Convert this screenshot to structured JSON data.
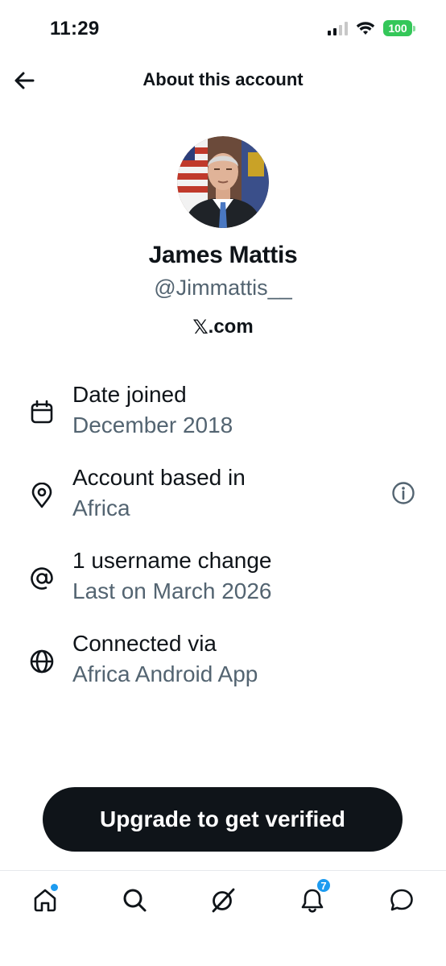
{
  "status_bar": {
    "time": "11:29",
    "battery": "100",
    "battery_color": "#34c759"
  },
  "header": {
    "back_icon": "arrow-left-icon",
    "title": "About this account"
  },
  "profile": {
    "avatar_alt": "profile photo",
    "display_name": "James Mattis",
    "handle": "@Jimmattis__",
    "platform_logo": "𝕏",
    "platform_suffix": ".com"
  },
  "info_rows": [
    {
      "icon": "calendar-icon",
      "label": "Date joined",
      "value": "December 2018"
    },
    {
      "icon": "location-pin-icon",
      "label": "Account based in",
      "value": "Africa",
      "action_icon": "info-icon"
    },
    {
      "icon": "at-sign-icon",
      "label": "1 username change",
      "value": "Last on March 2026"
    },
    {
      "icon": "globe-icon",
      "label": "Connected via",
      "value": "Africa Android App"
    }
  ],
  "cta": {
    "label": "Upgrade to get verified"
  },
  "tabbar": {
    "items": [
      {
        "icon": "home-icon",
        "badge_dot": true
      },
      {
        "icon": "search-icon"
      },
      {
        "icon": "grok-icon"
      },
      {
        "icon": "bell-icon",
        "badge_count": "7"
      },
      {
        "icon": "chat-icon"
      }
    ],
    "accent": "#1d9bf0"
  },
  "colors": {
    "text_primary": "#0f1419",
    "text_secondary": "#536471",
    "button_bg": "#0f1419"
  }
}
